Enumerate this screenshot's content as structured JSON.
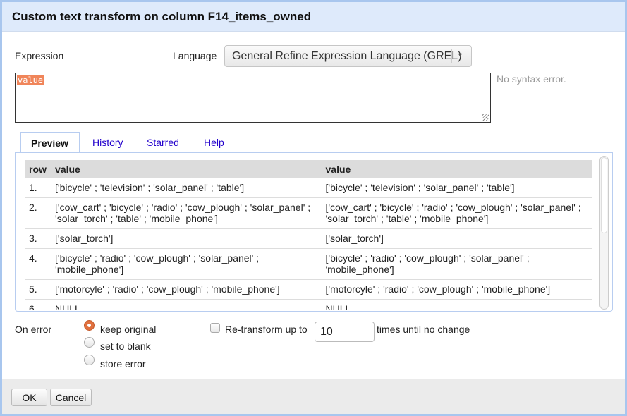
{
  "dialog": {
    "title": "Custom text transform on column F14_items_owned"
  },
  "expression": {
    "label": "Expression",
    "value": "value",
    "status": "No syntax error."
  },
  "language": {
    "label": "Language",
    "selected": "General Refine Expression Language (GREL)"
  },
  "tabs": [
    {
      "label": "Preview",
      "active": true
    },
    {
      "label": "History"
    },
    {
      "label": "Starred"
    },
    {
      "label": "Help"
    }
  ],
  "preview": {
    "headers": [
      "row",
      "value",
      "value"
    ],
    "rows": [
      {
        "n": "1.",
        "orig": "['bicycle' ; 'television' ; 'solar_panel' ; 'table']",
        "new": "['bicycle' ; 'television' ; 'solar_panel' ; 'table']"
      },
      {
        "n": "2.",
        "orig": "['cow_cart' ; 'bicycle' ; 'radio' ; 'cow_plough' ; 'solar_panel' ; 'solar_torch' ; 'table' ; 'mobile_phone']",
        "new": "['cow_cart' ; 'bicycle' ; 'radio' ; 'cow_plough' ; 'solar_panel' ; 'solar_torch' ; 'table' ; 'mobile_phone']"
      },
      {
        "n": "3.",
        "orig": "['solar_torch']",
        "new": "['solar_torch']"
      },
      {
        "n": "4.",
        "orig": "['bicycle' ; 'radio' ; 'cow_plough' ; 'solar_panel' ; 'mobile_phone']",
        "new": "['bicycle' ; 'radio' ; 'cow_plough' ; 'solar_panel' ; 'mobile_phone']"
      },
      {
        "n": "5.",
        "orig": "['motorcyle' ; 'radio' ; 'cow_plough' ; 'mobile_phone']",
        "new": "['motorcyle' ; 'radio' ; 'cow_plough' ; 'mobile_phone']"
      },
      {
        "n": "6.",
        "orig": "NULL",
        "new": "NULL"
      }
    ]
  },
  "on_error": {
    "label": "On error",
    "options": [
      "keep original",
      "set to blank",
      "store error"
    ],
    "selected": "keep original"
  },
  "retransform": {
    "label": "Re-transform up to",
    "value": "10",
    "suffix": "times until no change",
    "checked": false
  },
  "buttons": {
    "ok": "OK",
    "cancel": "Cancel"
  },
  "colors": {
    "accent": "#e0703e",
    "titlebar": "#deeafb",
    "link": "#2200cc"
  }
}
